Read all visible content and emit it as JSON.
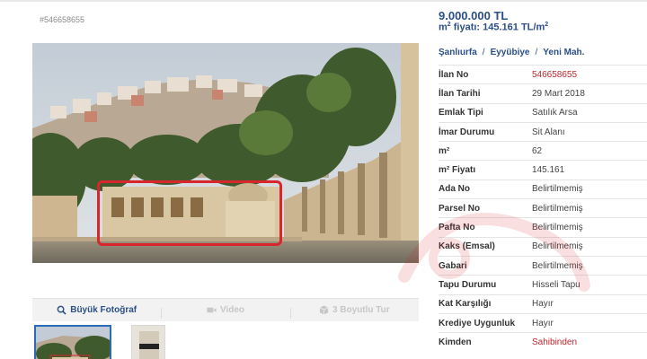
{
  "listing": {
    "number_label": "#546658655"
  },
  "price": {
    "total": "9.000.000 TL",
    "m2_prefix": "m",
    "m2_sup": "2",
    "m2_middle": " fiyatı: 145.161 TL/m",
    "m2_sup2": "2"
  },
  "location": [
    "Şanlıurfa",
    "Eyyübiye",
    "Yeni Mah."
  ],
  "location_separator": "/",
  "tabs": [
    {
      "label": "Büyük Fotoğraf",
      "icon": "search-icon",
      "active": true
    },
    {
      "label": "Video",
      "icon": "video-camera-icon",
      "active": false
    },
    {
      "label": "3 Boyutlu Tur",
      "icon": "cube-icon",
      "active": false
    }
  ],
  "details": [
    {
      "key": "İlan No",
      "value": "546658655",
      "red": true
    },
    {
      "key": "İlan Tarihi",
      "value": "29 Mart 2018",
      "red": false
    },
    {
      "key": "Emlak Tipi",
      "value": "Satılık Arsa",
      "red": false
    },
    {
      "key": "İmar Durumu",
      "value": "Sit Alanı",
      "red": false
    },
    {
      "key": "m²",
      "value": "62",
      "red": false
    },
    {
      "key": "m² Fiyatı",
      "value": "145.161",
      "red": false
    },
    {
      "key": "Ada No",
      "value": "Belirtilmemiş",
      "red": false
    },
    {
      "key": "Parsel No",
      "value": "Belirtilmemiş",
      "red": false
    },
    {
      "key": "Pafta No",
      "value": "Belirtilmemiş",
      "red": false
    },
    {
      "key": "Kaks (Emsal)",
      "value": "Belirtilmemiş",
      "red": false
    },
    {
      "key": "Gabari",
      "value": "Belirtilmemiş",
      "red": false
    },
    {
      "key": "Tapu Durumu",
      "value": "Hisseli Tapu",
      "red": false
    },
    {
      "key": "Kat Karşılığı",
      "value": "Hayır",
      "red": false
    },
    {
      "key": "Krediye Uygunluk",
      "value": "Hayır",
      "red": false
    },
    {
      "key": "Kimden",
      "value": "Sahibinden",
      "red": true
    }
  ],
  "colors": {
    "accent": "#2b4f86",
    "highlight": "#d8262c",
    "red_value": "#c0262c"
  }
}
